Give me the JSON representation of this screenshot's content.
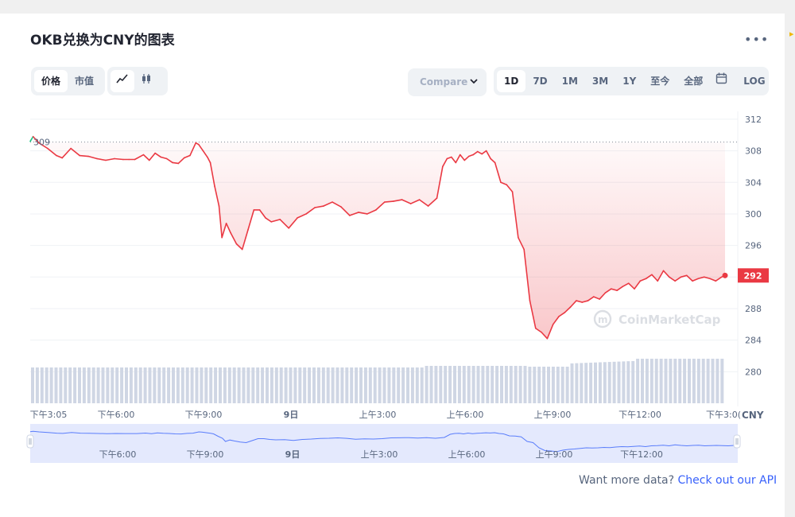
{
  "header": {
    "title": "OKB兑换为CNY的图表",
    "more_icon": "more-icon"
  },
  "toolbar": {
    "type_tabs": [
      "价格",
      "市值"
    ],
    "chart_style_icons": [
      "line-chart-icon",
      "candlestick-icon"
    ],
    "compare_label": "Compare",
    "ranges": [
      "1D",
      "7D",
      "1M",
      "3M",
      "1Y",
      "至今",
      "全部"
    ],
    "active_range": "1D",
    "log_label": "LOG",
    "calendar_icon": "calendar-icon"
  },
  "footer": {
    "text": "Want more data?",
    "link": "Check out our API"
  },
  "watermark": "CoinMarketCap",
  "colors": {
    "line": "#ea3943",
    "up": "#16c784",
    "accent": "#3861fb"
  },
  "chart_data": {
    "type": "area",
    "currency": "CNY",
    "open_price_label": "309",
    "last_price_label": "292",
    "x_tick_labels": [
      "下午3:05",
      "下午6:00",
      "下午9:00",
      "9日",
      "上午3:00",
      "上午6:00",
      "上午9:00",
      "下午12:00",
      "下午3:0("
    ],
    "y_ticks": [
      312,
      308,
      304,
      300,
      296,
      292,
      288,
      284,
      280
    ],
    "ylim": [
      276,
      313
    ],
    "open_price": 309.1,
    "x_hours": [
      0,
      0.1,
      0.3,
      0.6,
      0.9,
      1.1,
      1.4,
      1.7,
      2.0,
      2.3,
      2.6,
      2.9,
      3.2,
      3.4,
      3.6,
      3.9,
      4.1,
      4.3,
      4.5,
      4.7,
      4.9,
      5.1,
      5.3,
      5.5,
      5.7,
      5.8,
      5.95,
      6.1,
      6.2,
      6.35,
      6.5,
      6.6,
      6.75,
      6.9,
      7.1,
      7.3,
      7.5,
      7.7,
      7.9,
      8.1,
      8.3,
      8.6,
      8.9,
      9.2,
      9.5,
      9.8,
      10.1,
      10.4,
      10.7,
      11.0,
      11.3,
      11.6,
      11.9,
      12.2,
      12.5,
      12.8,
      13.1,
      13.4,
      13.7,
      14.0,
      14.2,
      14.35,
      14.5,
      14.65,
      14.8,
      14.95,
      15.1,
      15.25,
      15.4,
      15.55,
      15.7,
      15.85,
      16.0,
      16.2,
      16.4,
      16.6,
      16.8,
      17.0,
      17.2,
      17.4,
      17.6,
      17.8,
      18.0,
      18.2,
      18.4,
      18.6,
      18.8,
      19.0,
      19.2,
      19.4,
      19.6,
      19.8,
      20.0,
      20.2,
      20.4,
      20.6,
      20.8,
      21.0,
      21.2,
      21.4,
      21.6,
      21.8,
      22.0,
      22.2,
      22.4,
      22.6,
      22.8,
      23.0,
      23.2,
      23.4,
      23.6,
      23.8,
      23.92
    ],
    "price": [
      309.2,
      309.8,
      309.0,
      308.3,
      307.4,
      307.1,
      308.3,
      307.4,
      307.3,
      307.0,
      306.8,
      307.0,
      306.9,
      306.9,
      306.9,
      307.5,
      306.8,
      307.7,
      307.2,
      307.0,
      306.5,
      306.4,
      307.1,
      307.4,
      309.0,
      308.8,
      308.0,
      307.2,
      306.5,
      303.5,
      301.0,
      297.0,
      298.8,
      297.6,
      296.2,
      295.5,
      298.0,
      300.5,
      300.5,
      299.5,
      299.0,
      299.3,
      298.2,
      299.5,
      300.0,
      300.8,
      301.0,
      301.5,
      300.9,
      299.8,
      300.2,
      300.0,
      300.5,
      301.5,
      301.6,
      301.8,
      301.3,
      301.8,
      301.0,
      302.0,
      306.0,
      307.0,
      307.2,
      306.5,
      307.5,
      306.8,
      307.3,
      307.5,
      307.9,
      307.6,
      308.0,
      307.0,
      306.5,
      304.0,
      303.7,
      302.8,
      297.0,
      295.5,
      289.0,
      285.5,
      285.0,
      284.2,
      286.0,
      287.0,
      287.5,
      288.2,
      289.0,
      288.8,
      289.0,
      289.5,
      289.2,
      290.0,
      290.5,
      290.3,
      290.8,
      291.2,
      290.5,
      291.5,
      291.8,
      292.3,
      291.5,
      292.8,
      292.0,
      291.5,
      292.0,
      292.2,
      291.5,
      291.8,
      292.0,
      291.8,
      291.5,
      292.0,
      292.2
    ]
  }
}
